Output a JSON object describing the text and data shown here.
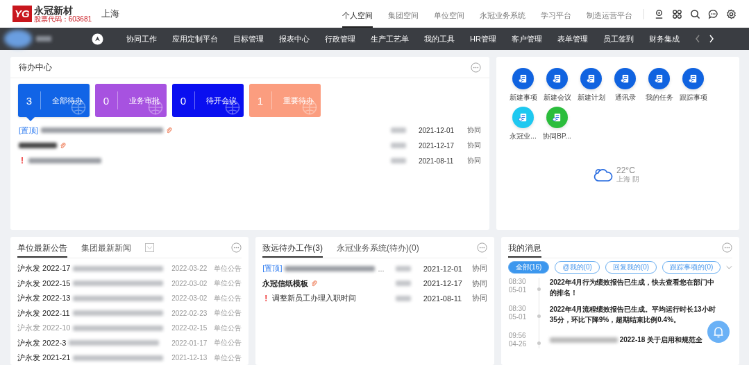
{
  "header": {
    "logo": {
      "mark": "YG",
      "name": "永冠新材",
      "stock": "股票代码：603681"
    },
    "city": "上海",
    "top_tabs": [
      {
        "label": "个人空间",
        "selected": true
      },
      {
        "label": "集团空间",
        "selected": false
      },
      {
        "label": "单位空间",
        "selected": false
      },
      {
        "label": "永冠业务系统",
        "selected": false
      },
      {
        "label": "学习平台",
        "selected": false
      },
      {
        "label": "制造运营平台",
        "selected": false
      }
    ]
  },
  "nav": {
    "items": [
      "协同工作",
      "应用定制平台",
      "目标管理",
      "报表中心",
      "行政管理",
      "生产工艺单",
      "我的工具",
      "HR管理",
      "客户管理",
      "表单管理",
      "员工签到",
      "财务集成"
    ]
  },
  "todo_center": {
    "title": "待办中心",
    "cards": [
      {
        "count": "3",
        "label": "全部待办",
        "color": "#1164e6",
        "selected": true
      },
      {
        "count": "0",
        "label": "业务审批",
        "color": "#a752e0",
        "selected": false
      },
      {
        "count": "0",
        "label": "待开会议",
        "color": "#0a0ff0",
        "selected": false
      },
      {
        "count": "1",
        "label": "重要待办",
        "color": "#fb9d7f",
        "selected": false
      }
    ],
    "rows": [
      {
        "kind": "pinned",
        "tag": "[置顶]",
        "attachment": true,
        "date": "2021-12-01",
        "category": "协同"
      },
      {
        "kind": "bold",
        "attachment": true,
        "date": "2021-12-17",
        "category": "协同"
      },
      {
        "kind": "urgent",
        "mark": "!",
        "attachment": false,
        "date": "2021-08-11",
        "category": "协同"
      }
    ]
  },
  "quick_apps": [
    {
      "label": "新建事项",
      "color": "#1063e0"
    },
    {
      "label": "新建会议",
      "color": "#1063e0"
    },
    {
      "label": "新建计划",
      "color": "#1063e0"
    },
    {
      "label": "通讯录",
      "color": "#1063e0"
    },
    {
      "label": "我的任务",
      "color": "#1063e0"
    },
    {
      "label": "跟踪事项",
      "color": "#1063e0"
    },
    {
      "label": "永冠业...",
      "color": "#1ec8f0"
    },
    {
      "label": "协同BP...",
      "color": "#2bbd3c"
    }
  ],
  "weather": {
    "temperature": "22°C",
    "place": "上海 阴"
  },
  "notices": {
    "tabs": [
      {
        "label": "单位最新公告",
        "selected": true
      },
      {
        "label": "集团最新新闻",
        "selected": false
      }
    ],
    "rows": [
      {
        "prefix": "沪永发 2022-17",
        "date": "2022-03-22",
        "category": "单位公告",
        "read": false
      },
      {
        "prefix": "沪永发 2022-15",
        "date": "2022-03-02",
        "category": "单位公告",
        "read": false
      },
      {
        "prefix": "沪永发 2022-13",
        "date": "2022-03-02",
        "category": "单位公告",
        "read": false
      },
      {
        "prefix": "沪永发 2022-11",
        "date": "2022-02-23",
        "category": "单位公告",
        "read": false
      },
      {
        "prefix": "沪永发 2022-10",
        "date": "2022-02-15",
        "category": "单位公告",
        "read": true
      },
      {
        "prefix": "沪永发 2022-3",
        "date": "2022-01-17",
        "category": "单位公告",
        "read": false
      },
      {
        "prefix": "沪永发 2021-21",
        "date": "2021-12-13",
        "category": "单位公告",
        "read": false
      }
    ]
  },
  "work": {
    "tabs": [
      {
        "label": "致远待办工作(3)",
        "selected": true
      },
      {
        "label": "永冠业务系统(待办)(0)",
        "selected": false
      }
    ],
    "rows": [
      {
        "kind": "pinned",
        "tag": "[置顶]",
        "title": "...",
        "attachment": false,
        "date": "2021-12-01",
        "category": "协同"
      },
      {
        "kind": "bold",
        "title": "永冠信纸模板",
        "attachment": true,
        "date": "2021-12-17",
        "category": "协同"
      },
      {
        "kind": "urgent",
        "mark": "!",
        "title": "调整新员工办理入职时间",
        "attachment": false,
        "date": "2021-08-11",
        "category": "协同"
      }
    ]
  },
  "messages": {
    "title": "我的消息",
    "filters": [
      {
        "label": "全部(16)",
        "selected": true
      },
      {
        "label": "@我的(0)",
        "selected": false
      },
      {
        "label": "回复我的(0)",
        "selected": false
      },
      {
        "label": "跟踪事项的(0)",
        "selected": false
      }
    ],
    "items": [
      {
        "time": "08:30",
        "date": "05-01",
        "text": "2022年4月行为绩效报告已生成，快去查看您在部门中的排名！"
      },
      {
        "time": "08:30",
        "date": "05-01",
        "text": "2022年4月流程绩效报告已生成。平均运行时长13小时35分，环比下降9%，超期结束比例0.4%。"
      },
      {
        "time": "09:56",
        "date": "04-26",
        "text": "2022-18 关于启用和规范全"
      }
    ]
  }
}
